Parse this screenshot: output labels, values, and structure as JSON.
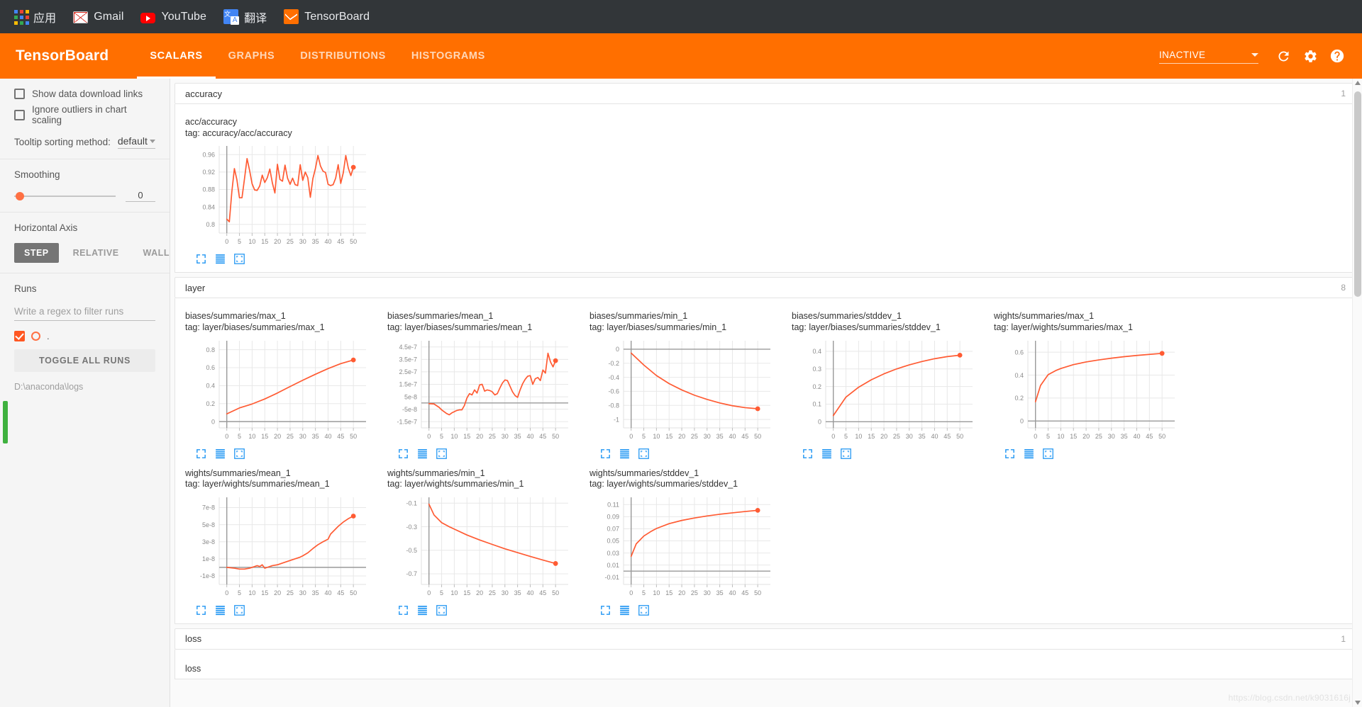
{
  "browser": {
    "bookmarks": [
      {
        "label": "应用",
        "icon": "apps-grid-icon"
      },
      {
        "label": "Gmail",
        "icon": "gmail-icon"
      },
      {
        "label": "YouTube",
        "icon": "youtube-icon"
      },
      {
        "label": "翻译",
        "icon": "translate-icon"
      },
      {
        "label": "TensorBoard",
        "icon": "tensorboard-icon"
      }
    ]
  },
  "appbar": {
    "logo": "TensorBoard",
    "tabs": [
      {
        "label": "SCALARS",
        "active": true
      },
      {
        "label": "GRAPHS",
        "active": false
      },
      {
        "label": "DISTRIBUTIONS",
        "active": false
      },
      {
        "label": "HISTOGRAMS",
        "active": false
      }
    ],
    "status": "INACTIVE",
    "reload_icon": "refresh-icon",
    "settings_icon": "gear-icon",
    "help_icon": "help-icon",
    "accent_color": "#ff6f00"
  },
  "sidebar": {
    "checkboxes": [
      {
        "label": "Show data download links",
        "checked": false
      },
      {
        "label": "Ignore outliers in chart scaling",
        "checked": false
      }
    ],
    "tooltip": {
      "label": "Tooltip sorting method:",
      "value": "default"
    },
    "smoothing": {
      "title": "Smoothing",
      "value": "0"
    },
    "horizontal_axis": {
      "title": "Horizontal Axis",
      "options": [
        {
          "label": "STEP",
          "active": true
        },
        {
          "label": "RELATIVE",
          "active": false
        },
        {
          "label": "WALL",
          "active": false
        }
      ]
    },
    "runs": {
      "title": "Runs",
      "filter_placeholder": "Write a regex to filter runs",
      "filter_value": "",
      "run_label": ".",
      "toggle_all_label": "TOGGLE ALL RUNS",
      "log_path": "D:\\anaconda\\logs",
      "run_color": "#ff5722"
    }
  },
  "watermark": "https://blog.csdn.net/k9031616j",
  "chart_data": [
    {
      "group": "accuracy",
      "group_count": "1",
      "type": "line",
      "title": "acc/accuracy",
      "tag": "tag: accuracy/acc/accuracy",
      "xlabel": "",
      "ylabel": "",
      "xlim": [
        -3,
        55
      ],
      "ylim": [
        0.78,
        0.98
      ],
      "xticks": [
        0,
        5,
        10,
        15,
        20,
        25,
        30,
        35,
        40,
        45,
        50
      ],
      "yticks": [
        0.8,
        0.84,
        0.88,
        0.92,
        0.96
      ],
      "ytick_labels": [
        "0.8",
        "0.84",
        "0.88",
        "0.92",
        "0.96"
      ],
      "color": "#ff5b33",
      "grid": true,
      "x": [
        0,
        1,
        2,
        3,
        4,
        5,
        6,
        7,
        8,
        9,
        10,
        11,
        12,
        13,
        14,
        15,
        16,
        17,
        18,
        19,
        20,
        21,
        22,
        23,
        24,
        25,
        26,
        27,
        28,
        29,
        30,
        31,
        32,
        33,
        34,
        35,
        36,
        37,
        38,
        39,
        40,
        41,
        42,
        43,
        44,
        45,
        46,
        47,
        48,
        49,
        50
      ],
      "y": [
        0.812,
        0.806,
        0.875,
        0.928,
        0.902,
        0.861,
        0.861,
        0.905,
        0.951,
        0.924,
        0.893,
        0.879,
        0.878,
        0.888,
        0.913,
        0.896,
        0.907,
        0.927,
        0.895,
        0.872,
        0.938,
        0.903,
        0.899,
        0.936,
        0.906,
        0.892,
        0.906,
        0.891,
        0.889,
        0.937,
        0.901,
        0.92,
        0.907,
        0.862,
        0.905,
        0.928,
        0.958,
        0.934,
        0.922,
        0.919,
        0.892,
        0.889,
        0.891,
        0.906,
        0.937,
        0.894,
        0.918,
        0.958,
        0.929,
        0.912,
        0.931
      ]
    },
    {
      "group": "layer",
      "group_count": "8",
      "type": "line",
      "title": "biases/summaries/max_1",
      "tag": "tag: layer/biases/summaries/max_1",
      "xlim": [
        -3,
        55
      ],
      "ylim": [
        -0.07,
        0.9
      ],
      "xticks": [
        0,
        5,
        10,
        15,
        20,
        25,
        30,
        35,
        40,
        45,
        50
      ],
      "yticks": [
        0,
        0.2,
        0.4,
        0.6,
        0.8
      ],
      "ytick_labels": [
        "0",
        "0.2",
        "0.4",
        "0.6",
        "0.8"
      ],
      "zero_line": 0,
      "color": "#ff5b33",
      "grid": true,
      "x": [
        0,
        5,
        10,
        15,
        20,
        25,
        30,
        35,
        40,
        45,
        50
      ],
      "y": [
        0.086,
        0.152,
        0.196,
        0.252,
        0.318,
        0.39,
        0.46,
        0.527,
        0.59,
        0.645,
        0.686
      ]
    },
    {
      "group": "layer",
      "type": "line",
      "title": "biases/summaries/mean_1",
      "tag": "tag: layer/biases/summaries/mean_1",
      "xlim": [
        -3,
        55
      ],
      "ylim": [
        -2e-07,
        5e-07
      ],
      "xticks": [
        0,
        5,
        10,
        15,
        20,
        25,
        30,
        35,
        40,
        45,
        50
      ],
      "yticks": [
        -1.5e-07,
        -5e-08,
        5e-08,
        1.5e-07,
        2.5e-07,
        3.5e-07,
        4.5e-07
      ],
      "ytick_labels": [
        "-1.5e-7",
        "-5e-8",
        "5e-8",
        "1.5e-7",
        "2.5e-7",
        "3.5e-7",
        "4.5e-7"
      ],
      "zero_line": 0,
      "color": "#ff5b33",
      "grid": true,
      "x": [
        0,
        2,
        4,
        5,
        6,
        7,
        8,
        9,
        10,
        11,
        12,
        13,
        14,
        15,
        16,
        17,
        18,
        19,
        20,
        21,
        22,
        23,
        24,
        25,
        26,
        27,
        28,
        29,
        30,
        31,
        32,
        33,
        34,
        35,
        36,
        37,
        38,
        39,
        40,
        41,
        42,
        43,
        44,
        45,
        46,
        47,
        48,
        49,
        50
      ],
      "y": [
        -5e-09,
        -8e-09,
        -3.5e-08,
        -5.5e-08,
        -7e-08,
        -8.5e-08,
        -9.5e-08,
        -8e-08,
        -7e-08,
        -6e-08,
        -5.5e-08,
        -5.5e-08,
        -2e-08,
        4e-08,
        7.5e-08,
        6.5e-08,
        1.05e-07,
        8e-08,
        1.45e-07,
        1.5e-07,
        9.5e-08,
        1.05e-07,
        1e-07,
        9e-08,
        6.5e-08,
        7.5e-08,
        1.2e-07,
        1.6e-07,
        1.85e-07,
        1.8e-07,
        1.35e-07,
        9e-08,
        6e-08,
        4.5e-08,
        1.05e-07,
        1.55e-07,
        1.9e-07,
        2.15e-07,
        2.2e-07,
        1.5e-07,
        1.95e-07,
        2.05e-07,
        1.8e-07,
        2.65e-07,
        2.4e-07,
        4e-07,
        3.3e-07,
        2.9e-07,
        3.4e-07
      ]
    },
    {
      "group": "layer",
      "type": "line",
      "title": "biases/summaries/min_1",
      "tag": "tag: layer/biases/summaries/min_1",
      "xlim": [
        -3,
        55
      ],
      "ylim": [
        -1.12,
        0.12
      ],
      "xticks": [
        0,
        5,
        10,
        15,
        20,
        25,
        30,
        35,
        40,
        45,
        50
      ],
      "yticks": [
        -1,
        -0.8,
        -0.6,
        -0.4,
        -0.2,
        0
      ],
      "ytick_labels": [
        "-1",
        "-0.8",
        "-0.6",
        "-0.4",
        "-0.2",
        "0"
      ],
      "zero_line": 0,
      "color": "#ff5b33",
      "grid": true,
      "x": [
        0,
        5,
        10,
        15,
        20,
        25,
        30,
        35,
        40,
        45,
        50
      ],
      "y": [
        -0.055,
        -0.225,
        -0.375,
        -0.49,
        -0.58,
        -0.655,
        -0.715,
        -0.765,
        -0.805,
        -0.832,
        -0.848
      ]
    },
    {
      "group": "layer",
      "type": "line",
      "title": "biases/summaries/stddev_1",
      "tag": "tag: layer/biases/summaries/stddev_1",
      "xlim": [
        -3,
        55
      ],
      "ylim": [
        -0.035,
        0.46
      ],
      "xticks": [
        0,
        5,
        10,
        15,
        20,
        25,
        30,
        35,
        40,
        45,
        50
      ],
      "yticks": [
        0,
        0.1,
        0.2,
        0.3,
        0.4
      ],
      "ytick_labels": [
        "0",
        "0.1",
        "0.2",
        "0.3",
        "0.4"
      ],
      "zero_line": 0,
      "color": "#ff5b33",
      "grid": true,
      "x": [
        0,
        5,
        10,
        15,
        20,
        25,
        30,
        35,
        40,
        45,
        50
      ],
      "y": [
        0.035,
        0.14,
        0.196,
        0.238,
        0.272,
        0.3,
        0.323,
        0.342,
        0.358,
        0.37,
        0.378
      ]
    },
    {
      "group": "layer",
      "type": "line",
      "title": "wights/summaries/max_1",
      "tag": "tag: layer/wights/summaries/max_1",
      "xlim": [
        -3,
        55
      ],
      "ylim": [
        -0.06,
        0.7
      ],
      "xticks": [
        0,
        5,
        10,
        15,
        20,
        25,
        30,
        35,
        40,
        45,
        50
      ],
      "yticks": [
        0,
        0.2,
        0.4,
        0.6
      ],
      "ytick_labels": [
        "0",
        "0.2",
        "0.4",
        "0.6"
      ],
      "zero_line": 0,
      "color": "#ff5b33",
      "grid": true,
      "x": [
        0,
        2,
        5,
        8,
        10,
        15,
        20,
        25,
        30,
        35,
        40,
        45,
        50
      ],
      "y": [
        0.168,
        0.31,
        0.404,
        0.44,
        0.458,
        0.492,
        0.515,
        0.533,
        0.548,
        0.561,
        0.572,
        0.581,
        0.59
      ]
    },
    {
      "group": "layer",
      "type": "line",
      "title": "wights/summaries/mean_1",
      "tag": "tag: layer/wights/summaries/mean_1",
      "xlim": [
        -3,
        55
      ],
      "ylim": [
        -2e-08,
        8.2e-08
      ],
      "xticks": [
        0,
        5,
        10,
        15,
        20,
        25,
        30,
        35,
        40,
        45,
        50
      ],
      "yticks": [
        -1e-08,
        1e-08,
        3e-08,
        5e-08,
        7e-08
      ],
      "ytick_labels": [
        "-1e-8",
        "1e-8",
        "3e-8",
        "5e-8",
        "7e-8"
      ],
      "zero_line": 0,
      "color": "#ff5b33",
      "grid": true,
      "x": [
        0,
        3,
        5,
        7,
        9,
        11,
        12,
        13,
        14,
        15,
        16,
        17,
        18,
        20,
        22,
        25,
        27,
        29,
        30,
        32,
        34,
        36,
        38,
        40,
        41,
        42,
        44,
        46,
        48,
        50
      ],
      "y": [
        0,
        -1e-09,
        -2e-09,
        -2e-09,
        -1e-09,
        1e-09,
        2e-09,
        1e-09,
        3e-09,
        -1e-09,
        0,
        1e-09,
        2e-09,
        3e-09,
        5e-09,
        8e-09,
        1e-08,
        1.2e-08,
        1.35e-08,
        1.7e-08,
        2.2e-08,
        2.65e-08,
        3e-08,
        3.3e-08,
        3.9e-08,
        4.2e-08,
        4.8e-08,
        5.3e-08,
        5.7e-08,
        6e-08
      ]
    },
    {
      "group": "layer",
      "type": "line",
      "title": "wights/summaries/min_1",
      "tag": "tag: layer/wights/summaries/min_1",
      "xlim": [
        -3,
        55
      ],
      "ylim": [
        -0.79,
        -0.05
      ],
      "xticks": [
        0,
        5,
        10,
        15,
        20,
        25,
        30,
        35,
        40,
        45,
        50
      ],
      "yticks": [
        -0.7,
        -0.5,
        -0.3,
        -0.1
      ],
      "ytick_labels": [
        "-0.7",
        "-0.5",
        "-0.3",
        "-0.1"
      ],
      "color": "#ff5b33",
      "grid": true,
      "x": [
        0,
        2,
        5,
        8,
        10,
        15,
        20,
        25,
        30,
        35,
        40,
        45,
        50
      ],
      "y": [
        -0.108,
        -0.2,
        -0.265,
        -0.3,
        -0.32,
        -0.37,
        -0.412,
        -0.45,
        -0.487,
        -0.52,
        -0.552,
        -0.583,
        -0.612
      ]
    },
    {
      "group": "layer",
      "type": "line",
      "title": "wights/summaries/stddev_1",
      "tag": "tag: layer/wights/summaries/stddev_1",
      "xlim": [
        -3,
        55
      ],
      "ylim": [
        -0.022,
        0.122
      ],
      "xticks": [
        0,
        5,
        10,
        15,
        20,
        25,
        30,
        35,
        40,
        45,
        50
      ],
      "yticks": [
        -0.01,
        0.01,
        0.03,
        0.05,
        0.07,
        0.09,
        0.11
      ],
      "ytick_labels": [
        "-0.01",
        "0.01",
        "0.03",
        "0.05",
        "0.07",
        "0.09",
        "0.11"
      ],
      "zero_line": 0,
      "color": "#ff5b33",
      "grid": true,
      "x": [
        0,
        2,
        5,
        8,
        10,
        15,
        20,
        25,
        30,
        35,
        40,
        45,
        50
      ],
      "y": [
        0.0245,
        0.045,
        0.058,
        0.066,
        0.0705,
        0.0785,
        0.0838,
        0.0878,
        0.0912,
        0.094,
        0.0963,
        0.0985,
        0.1005
      ]
    },
    {
      "group": "loss",
      "group_count": "1",
      "type": "line",
      "title": "loss",
      "tag": "",
      "color": "#ff5b33",
      "x": [],
      "y": []
    }
  ],
  "groups": [
    {
      "name": "accuracy",
      "count": "1"
    },
    {
      "name": "layer",
      "count": "8"
    },
    {
      "name": "loss",
      "count": "1"
    }
  ],
  "chart_tools": {
    "expand_icon": "expand-icon",
    "lines_icon": "data-series-icon",
    "fit_icon": "fit-domain-icon"
  }
}
